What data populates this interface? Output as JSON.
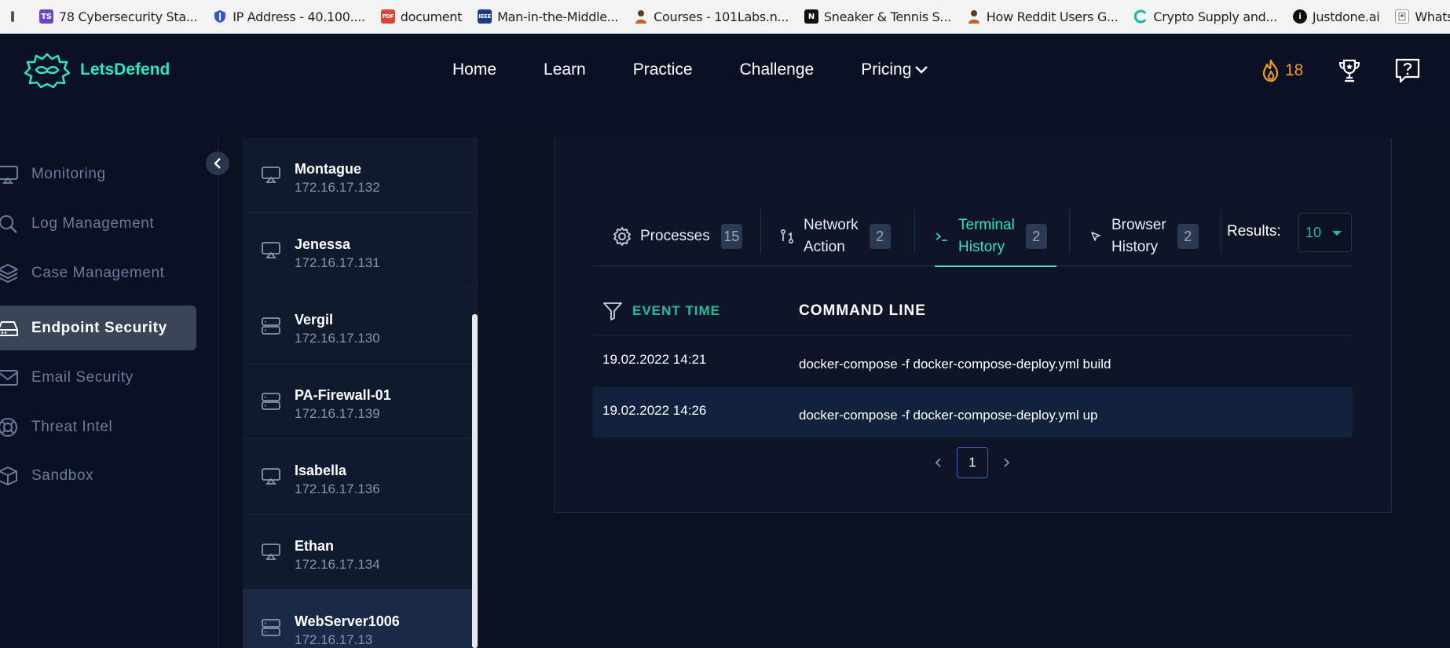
{
  "bookmarks": [
    {
      "label": "78 Cybersecurity Sta...",
      "icon": "ts-icon",
      "color": "#6a44c9"
    },
    {
      "label": "IP Address - 40.100....",
      "icon": "shield-icon",
      "color": "#2b58d8"
    },
    {
      "label": "document",
      "icon": "pdf-icon",
      "color": "#d8453a"
    },
    {
      "label": "Man-in-the-Middle...",
      "icon": "ieee-icon",
      "color": "#1b3a8c"
    },
    {
      "label": "Courses - 101Labs.n...",
      "icon": "avatar-icon",
      "color": "#7a4a2a"
    },
    {
      "label": "Sneaker & Tennis S...",
      "icon": "notion-icon",
      "color": "#111111"
    },
    {
      "label": "How Reddit Users G...",
      "icon": "avatar-icon",
      "color": "#7a4a2a"
    },
    {
      "label": "Crypto Supply and...",
      "icon": "crypto-icon",
      "color": "#19b6a8"
    },
    {
      "label": "Justdone.ai",
      "icon": "info-icon",
      "color": "#111111"
    },
    {
      "label": "WhatsMyName Web",
      "icon": "page-icon",
      "color": "#888888"
    }
  ],
  "brand": {
    "name": "LetsDefend"
  },
  "nav": {
    "home": "Home",
    "learn": "Learn",
    "practice": "Practice",
    "challenge": "Challenge",
    "pricing": "Pricing"
  },
  "streak": {
    "count": "18"
  },
  "sidebar": {
    "items": [
      {
        "label": "Monitoring",
        "icon": "monitor-icon"
      },
      {
        "label": "Log Management",
        "icon": "search-icon"
      },
      {
        "label": "Case Management",
        "icon": "layers-icon"
      },
      {
        "label": "Endpoint Security",
        "icon": "drive-icon",
        "active": true
      },
      {
        "label": "Email Security",
        "icon": "mail-icon"
      },
      {
        "label": "Threat Intel",
        "icon": "lifebuoy-icon"
      },
      {
        "label": "Sandbox",
        "icon": "cube-icon"
      }
    ]
  },
  "hosts": [
    {
      "name": "Montague",
      "ip": "172.16.17.132",
      "type": "workstation"
    },
    {
      "name": "Jenessa",
      "ip": "172.16.17.131",
      "type": "workstation"
    },
    {
      "name": "Vergil",
      "ip": "172.16.17.130",
      "type": "server"
    },
    {
      "name": "PA-Firewall-01",
      "ip": "172.16.17.139",
      "type": "server"
    },
    {
      "name": "Isabella",
      "ip": "172.16.17.136",
      "type": "workstation"
    },
    {
      "name": "Ethan",
      "ip": "172.16.17.134",
      "type": "workstation"
    },
    {
      "name": "WebServer1006",
      "ip": "172.16.17.13",
      "type": "server",
      "active": true
    }
  ],
  "tabs": [
    {
      "label": "Processes",
      "count": "15"
    },
    {
      "label": "Network Action",
      "line1": "Network",
      "line2": "Action",
      "count": "2"
    },
    {
      "label": "Terminal History",
      "line1": "Terminal",
      "line2": "History",
      "count": "2",
      "active": true
    },
    {
      "label": "Browser History",
      "line1": "Browser",
      "line2": "History",
      "count": "2"
    }
  ],
  "results": {
    "label": "Results:",
    "value": "10"
  },
  "table": {
    "headers": {
      "time": "EVENT TIME",
      "command": "COMMAND LINE"
    },
    "rows": [
      {
        "time": "19.02.2022 14:21",
        "command": "docker-compose -f docker-compose-deploy.yml build"
      },
      {
        "time": "19.02.2022 14:26",
        "command": "docker-compose -f docker-compose-deploy.yml up"
      }
    ]
  },
  "pagination": {
    "current": "1"
  },
  "colors": {
    "accent": "#2ee6c5",
    "streak": "#f59a23",
    "pager_border": "#4a5bd0"
  }
}
